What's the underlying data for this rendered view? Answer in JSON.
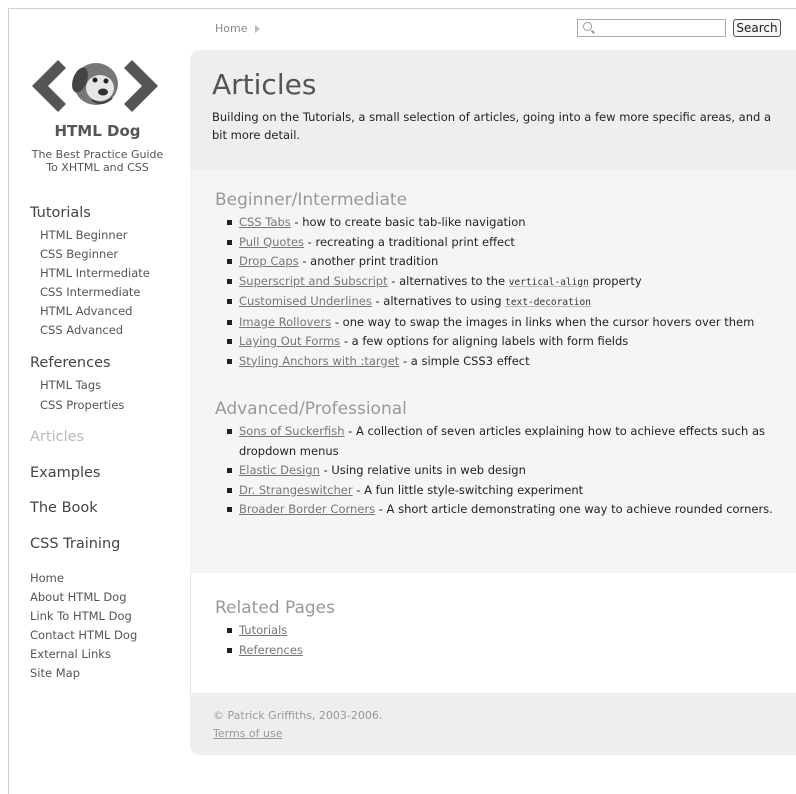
{
  "header": {
    "breadcrumb_home": "Home",
    "search_placeholder": "",
    "search_button": "Search"
  },
  "sidebar": {
    "brand": "HTML Dog",
    "tagline": "The Best Practice Guide To XHTML and CSS",
    "tutorials": {
      "heading": "Tutorials",
      "items": [
        "HTML Beginner",
        "CSS Beginner",
        "HTML Intermediate",
        "CSS Intermediate",
        "HTML Advanced",
        "CSS Advanced"
      ]
    },
    "references": {
      "heading": "References",
      "items": [
        "HTML Tags",
        "CSS Properties"
      ]
    },
    "articles": "Articles",
    "examples": "Examples",
    "book": "The Book",
    "training": "CSS Training",
    "footer_links": [
      "Home",
      "About HTML Dog",
      "Link To HTML Dog",
      "Contact HTML Dog",
      "External Links",
      "Site Map"
    ]
  },
  "main": {
    "title": "Articles",
    "lead": "Building on the Tutorials, a small selection of articles, going into a few more specific areas, and a bit more detail.",
    "beginner": {
      "heading": "Beginner/Intermediate",
      "items": [
        {
          "link": "CSS Tabs",
          "desc": " - how to create basic tab-like navigation"
        },
        {
          "link": "Pull Quotes",
          "desc": " - recreating a traditional print effect"
        },
        {
          "link": "Drop Caps",
          "desc": " - another print tradition"
        },
        {
          "link": "Superscript and Subscript",
          "desc": " - alternatives to the ",
          "code": "vertical-align",
          "tail": " property"
        },
        {
          "link": "Customised Underlines",
          "desc": " - alternatives to using ",
          "code": "text-decoration",
          "tail": ""
        },
        {
          "link": "Image Rollovers",
          "desc": " - one way to swap the images in links when the cursor hovers over them"
        },
        {
          "link": "Laying Out Forms",
          "desc": " - a few options for aligning labels with form fields"
        },
        {
          "link": "Styling Anchors with :target",
          "desc": " - a simple CSS3 effect"
        }
      ]
    },
    "advanced": {
      "heading": "Advanced/Professional",
      "items": [
        {
          "link": "Sons of Suckerfish",
          "desc": " - A collection of seven articles explaining how to achieve effects such as dropdown menus"
        },
        {
          "link": "Elastic Design",
          "desc": " - Using relative units in web design"
        },
        {
          "link": "Dr. Strangeswitcher",
          "desc": " - A fun little style-switching experiment"
        },
        {
          "link": "Broader Border Corners",
          "desc": " - A short article demonstrating one way to achieve rounded corners."
        }
      ]
    },
    "related": {
      "heading": "Related Pages",
      "items": [
        "Tutorials",
        "References"
      ]
    }
  },
  "footer": {
    "copyright": "© Patrick Griffiths, 2003-2006.",
    "terms": "Terms of use"
  }
}
